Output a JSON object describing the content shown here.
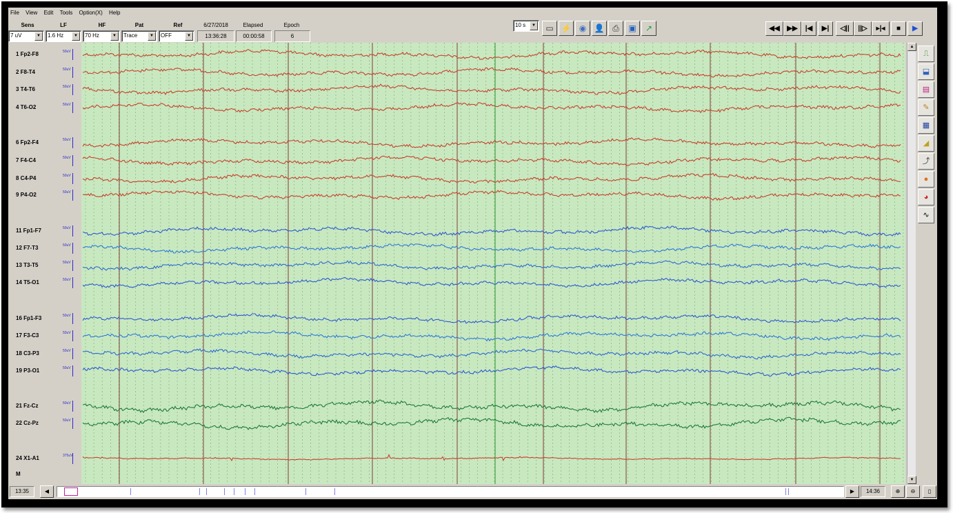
{
  "menu": [
    "File",
    "View",
    "Edit",
    "Tools",
    "Option(X)",
    "Help"
  ],
  "toolbar": {
    "sens": {
      "label": "Sens",
      "value": "7 uV"
    },
    "lf": {
      "label": "LF",
      "value": "1.6 Hz"
    },
    "hf": {
      "label": "HF",
      "value": "70 Hz"
    },
    "pat": {
      "label": "Pat",
      "value": "Trace"
    },
    "ref": {
      "label": "Ref",
      "value": "OFF"
    },
    "date": {
      "label": "6/27/2018",
      "value": "13:36:28"
    },
    "elapsed": {
      "label": "Elapsed",
      "value": "00:00:58"
    },
    "epoch": {
      "label": "Epoch",
      "value": "6"
    },
    "timebase": "10 s"
  },
  "channels": [
    {
      "label": "1  Fp2-F8",
      "scale": "50uV",
      "color": "#c8402a"
    },
    {
      "label": "2  F8-T4",
      "scale": "50uV",
      "color": "#c8402a"
    },
    {
      "label": "3  T4-T6",
      "scale": "50uV",
      "color": "#c8402a"
    },
    {
      "label": "4  T6-O2",
      "scale": "50uV",
      "color": "#c8402a"
    },
    {
      "label": "6  Fp2-F4",
      "scale": "50uV",
      "color": "#c8402a"
    },
    {
      "label": "7  F4-C4",
      "scale": "50uV",
      "color": "#c8402a"
    },
    {
      "label": "8  C4-P4",
      "scale": "50uV",
      "color": "#c8402a"
    },
    {
      "label": "9  P4-O2",
      "scale": "50uV",
      "color": "#c8402a"
    },
    {
      "label": "11  Fp1-F7",
      "scale": "50uV",
      "color": "#2c5ad0"
    },
    {
      "label": "12  F7-T3",
      "scale": "50uV",
      "color": "#2c7ad8"
    },
    {
      "label": "13  T3-T5",
      "scale": "50uV",
      "color": "#2c6ad0"
    },
    {
      "label": "14  T5-O1",
      "scale": "50uV",
      "color": "#2c5ad0"
    },
    {
      "label": "16  Fp1-F3",
      "scale": "50uV",
      "color": "#2c5ad0"
    },
    {
      "label": "17  F3-C3",
      "scale": "50uV",
      "color": "#2c7ad8"
    },
    {
      "label": "18  C3-P3",
      "scale": "50uV",
      "color": "#2c6ad0"
    },
    {
      "label": "19  P3-O1",
      "scale": "50uV",
      "color": "#2c5ad0"
    },
    {
      "label": "21  Fz-Cz",
      "scale": "50uV",
      "color": "#1e7a38"
    },
    {
      "label": "22  Cz-Pz",
      "scale": "50uV",
      "color": "#1e7a38"
    },
    {
      "label": "24  X1-A1",
      "scale": "375uV",
      "color": "#c8402a"
    }
  ],
  "marker_label": "M",
  "status": {
    "start_time": "13:35",
    "end_time": "14:36"
  },
  "colors": {
    "plot_bg": "#c8e8c0",
    "grid_dotted": "#6a8a6a",
    "second_line": "#7a2a2a"
  }
}
